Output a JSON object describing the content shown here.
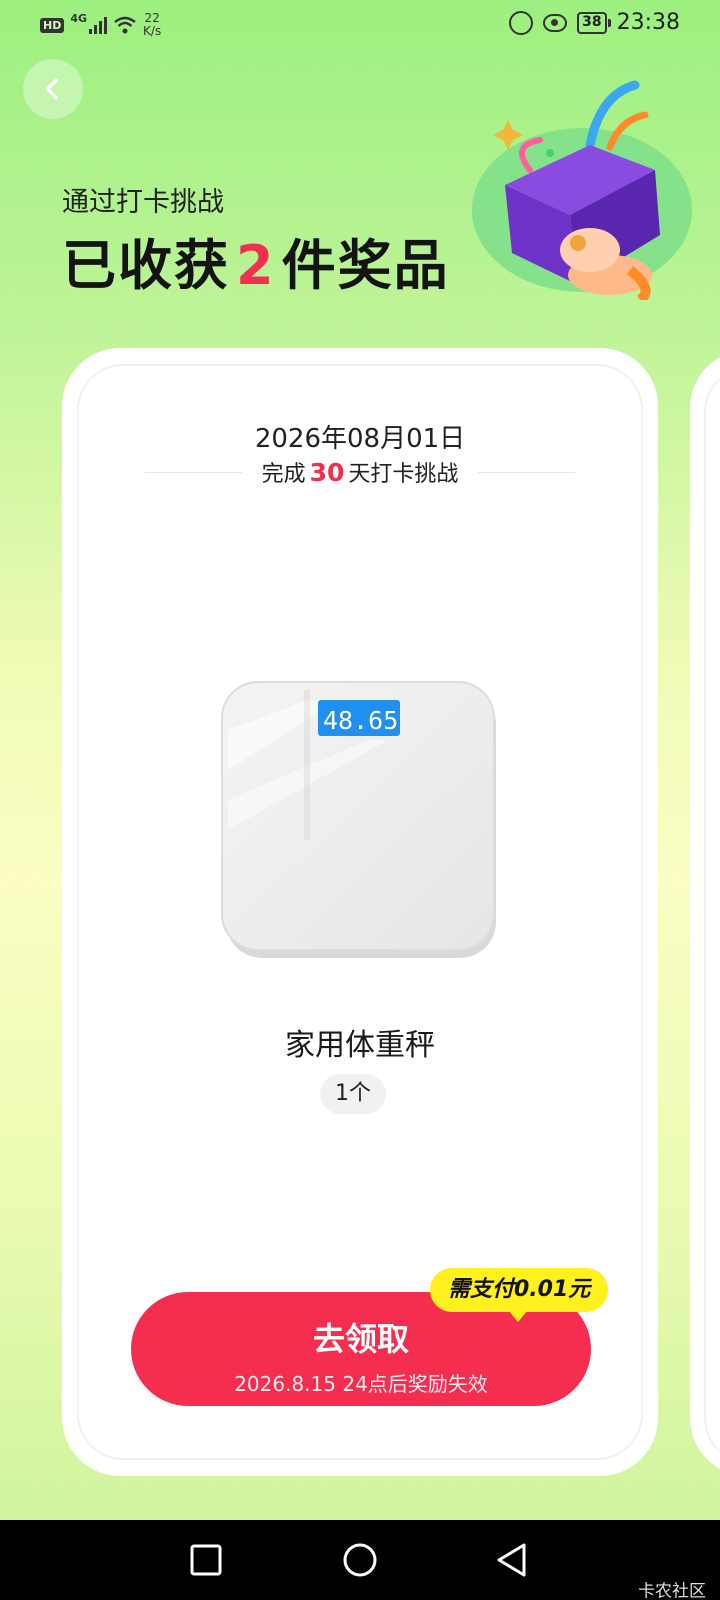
{
  "status_bar": {
    "hd": "HD",
    "network": "4G",
    "net_speed_value": "22",
    "net_speed_unit": "K/s",
    "nfc_icon": "nfc-icon",
    "battery": "38",
    "time": "23:38"
  },
  "header": {
    "subtitle": "通过打卡挑战",
    "title_prefix": "已收获",
    "prize_count": "2",
    "title_suffix": "件奖品"
  },
  "card": {
    "date": "2026年08月01日",
    "challenge_prefix": "完成",
    "challenge_days": "30",
    "challenge_suffix": "天打卡挑战",
    "product_name": "家用体重秤",
    "scale_display": "48.65",
    "quantity": "1个",
    "claim_label": "去领取",
    "claim_expiry": "2026.8.15 24点后奖励失效",
    "pay_tag": "需支付0.01元"
  },
  "nav": {
    "watermark": "卡农社区"
  },
  "colors": {
    "accent_red": "#f52d4f",
    "highlight_red": "#f0304e",
    "tag_yellow": "#fff01e",
    "bg_green": "#9cf07f"
  }
}
